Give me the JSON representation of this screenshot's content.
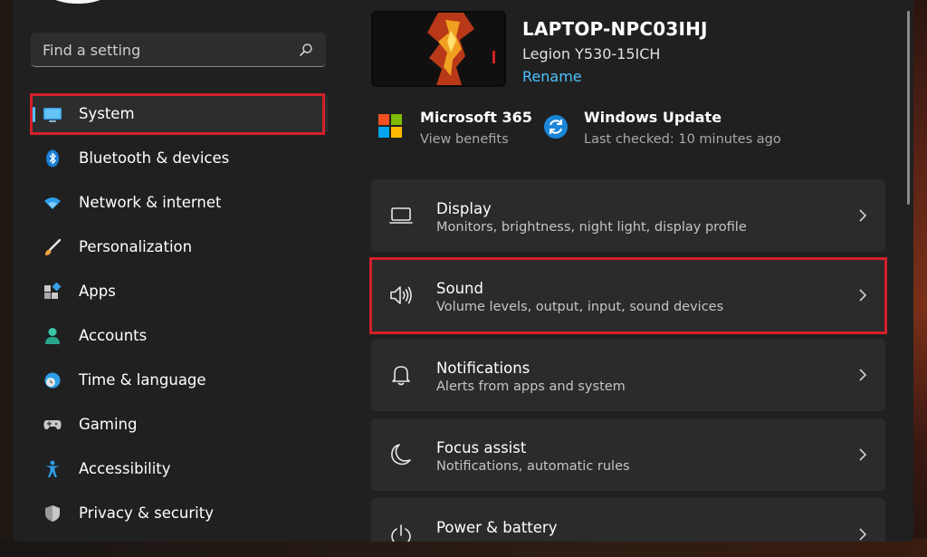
{
  "search": {
    "placeholder": "Find a setting",
    "icon": "search-icon"
  },
  "sidebar": {
    "items": [
      {
        "label": "System",
        "icon": "monitor-icon",
        "selected": true
      },
      {
        "label": "Bluetooth & devices",
        "icon": "bluetooth-icon"
      },
      {
        "label": "Network & internet",
        "icon": "wifi-icon"
      },
      {
        "label": "Personalization",
        "icon": "brush-icon"
      },
      {
        "label": "Apps",
        "icon": "apps-icon"
      },
      {
        "label": "Accounts",
        "icon": "person-icon"
      },
      {
        "label": "Time & language",
        "icon": "globe-clock-icon"
      },
      {
        "label": "Gaming",
        "icon": "gamepad-icon"
      },
      {
        "label": "Accessibility",
        "icon": "accessibility-icon"
      },
      {
        "label": "Privacy & security",
        "icon": "shield-icon"
      }
    ]
  },
  "device": {
    "name": "LAPTOP-NPC03IHJ",
    "model": "Legion Y530-15ICH",
    "rename_label": "Rename"
  },
  "promos": [
    {
      "title": "Microsoft 365",
      "subtitle": "View benefits",
      "icon": "microsoft-logo-icon"
    },
    {
      "title": "Windows Update",
      "subtitle": "Last checked: 10 minutes ago",
      "icon": "update-icon"
    }
  ],
  "cards": [
    {
      "title": "Display",
      "subtitle": "Monitors, brightness, night light, display profile",
      "icon": "display-icon"
    },
    {
      "title": "Sound",
      "subtitle": "Volume levels, output, input, sound devices",
      "icon": "speaker-icon"
    },
    {
      "title": "Notifications",
      "subtitle": "Alerts from apps and system",
      "icon": "bell-icon"
    },
    {
      "title": "Focus assist",
      "subtitle": "Notifications, automatic rules",
      "icon": "moon-icon"
    },
    {
      "title": "Power & battery",
      "subtitle": "",
      "icon": "power-icon"
    }
  ],
  "colors": {
    "accent": "#4cc2ff",
    "highlight": "#d4202a",
    "window_bg": "#202020",
    "card_bg": "#2b2b2b"
  }
}
